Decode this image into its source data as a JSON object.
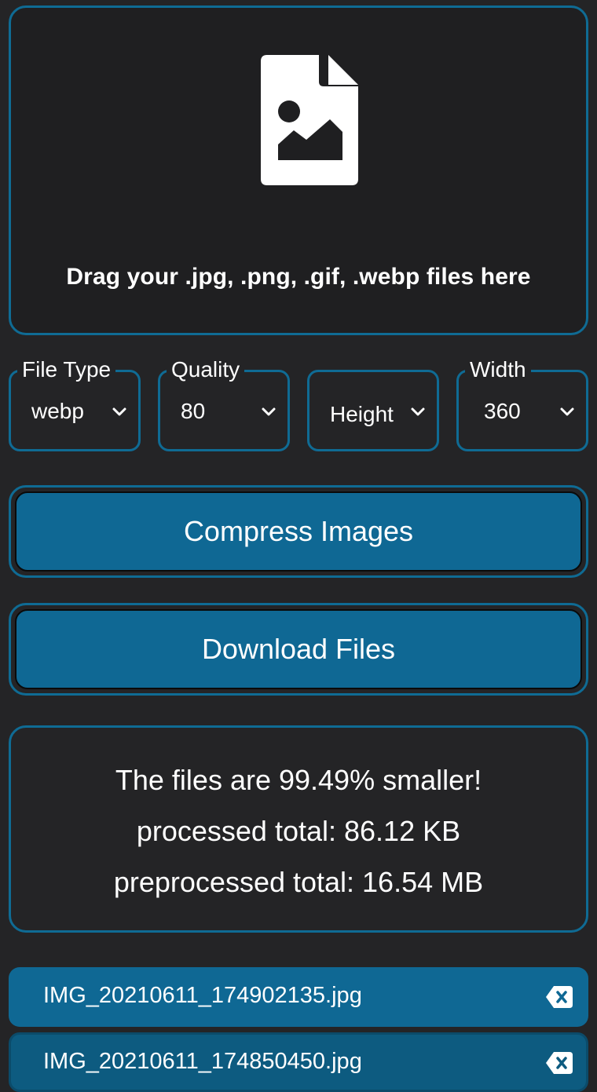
{
  "dropzone": {
    "icon": "image-file-icon",
    "text": "Drag your .jpg, .png, .gif, .webp files here"
  },
  "options": {
    "file_type": {
      "label": "File Type",
      "value": "webp"
    },
    "quality": {
      "label": "Quality",
      "value": "80"
    },
    "height": {
      "label": "",
      "placeholder": "Height"
    },
    "width": {
      "label": "Width",
      "value": "360"
    }
  },
  "actions": {
    "compress_label": "Compress Images",
    "download_label": "Download Files"
  },
  "stats": {
    "smaller": "The files are 99.49% smaller!",
    "processed": "processed total: 86.12 KB",
    "preprocessed": "preprocessed total: 16.54 MB"
  },
  "files": [
    {
      "name": "IMG_20210611_174902135.jpg",
      "icon": "backspace-delete-icon"
    },
    {
      "name": "IMG_20210611_174850450.jpg",
      "icon": "backspace-delete-icon"
    }
  ],
  "colors": {
    "background": "#242426",
    "accent": "#0f6894",
    "border": "#0f6b94",
    "text": "#ffffff"
  }
}
